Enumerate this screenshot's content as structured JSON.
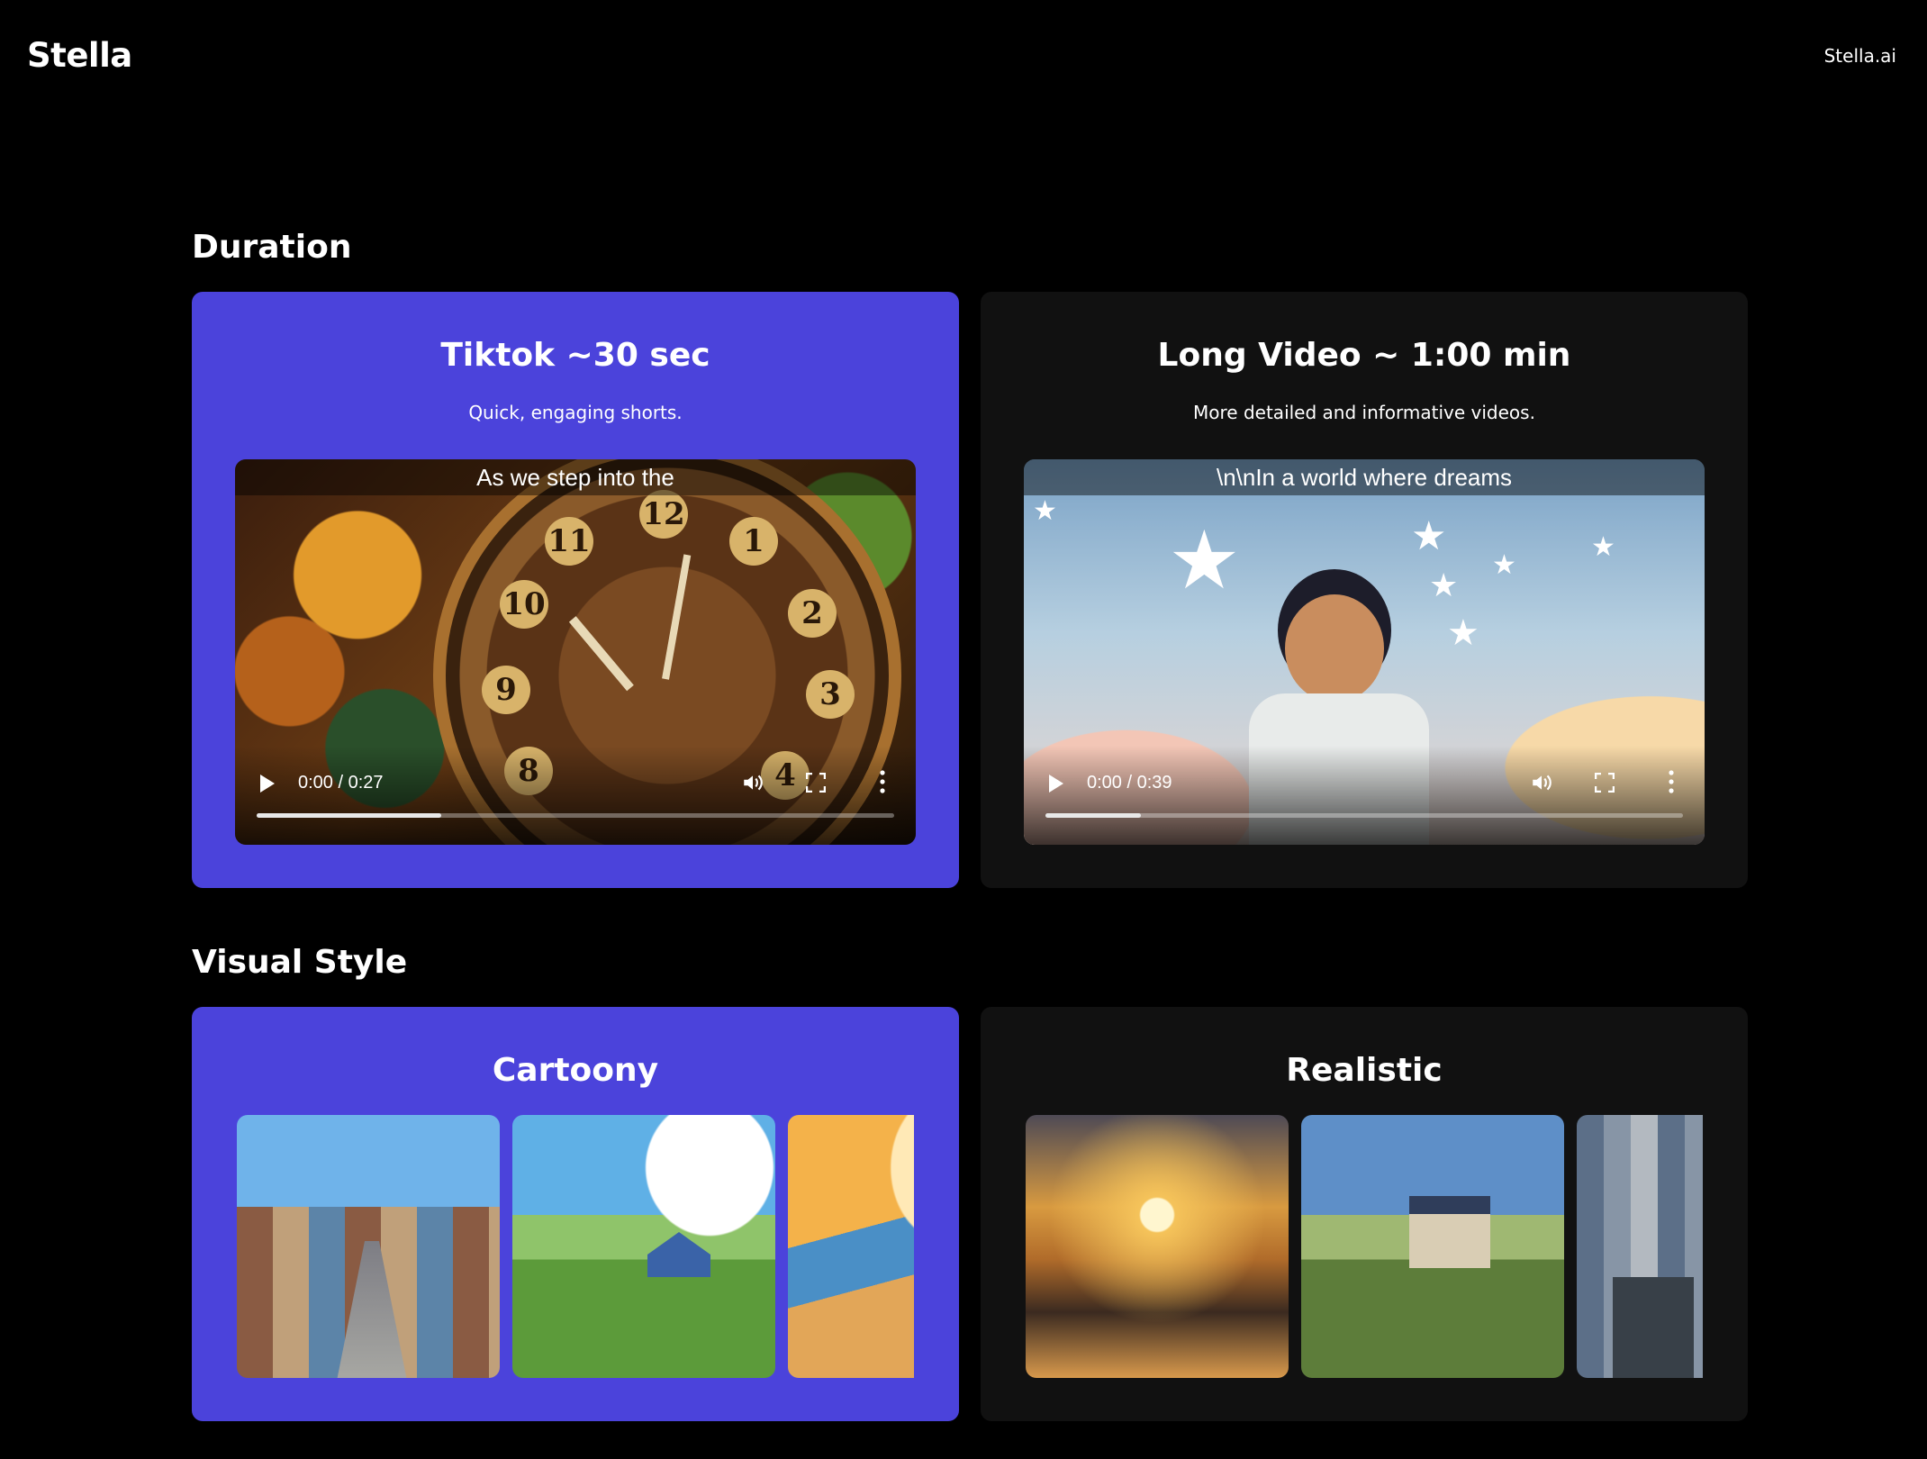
{
  "header": {
    "brand": "Stella",
    "nav_link": "Stella.ai"
  },
  "sections": {
    "duration_title": "Duration",
    "visual_style_title": "Visual Style"
  },
  "duration_options": [
    {
      "title": "Tiktok ~30 sec",
      "subtitle": "Quick, engaging shorts.",
      "selected": true,
      "video": {
        "caption": "As we step into the",
        "time": "0:00 / 0:27",
        "progress_fraction": 0.29
      }
    },
    {
      "title": "Long Video ~ 1:00 min",
      "subtitle": "More detailed and informative videos.",
      "selected": false,
      "video": {
        "caption": "\\n\\nIn a world where dreams",
        "time": "0:00 / 0:39",
        "progress_fraction": 0.15
      }
    }
  ],
  "visual_styles": [
    {
      "title": "Cartoony",
      "selected": true
    },
    {
      "title": "Realistic",
      "selected": false
    }
  ],
  "colors": {
    "background": "#000000",
    "selected_card": "#4b43db",
    "unselected_card": "#111111",
    "text": "#ffffff"
  },
  "icons": [
    "play-icon",
    "volume-icon",
    "fullscreen-icon",
    "more-options-icon"
  ]
}
